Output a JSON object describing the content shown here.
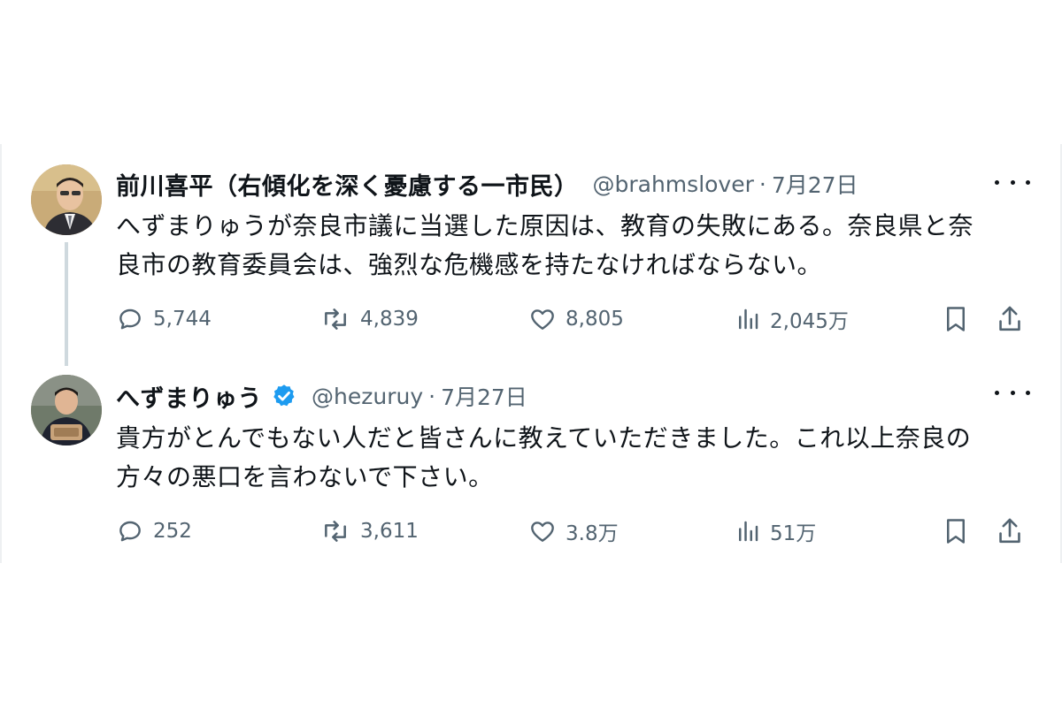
{
  "tweets": [
    {
      "author_name": "前川喜平（右傾化を深く憂慮する一市民）",
      "handle": "@brahmslover",
      "separator": "·",
      "date": "7月27日",
      "verified": false,
      "text_line1": "へずまりゅうが奈良市議に当選した原因は、教育の失敗にある。奈良県と奈",
      "text_line2": "良市の教育委員会は、強烈な危機感を持たなければならない。",
      "replies": "5,744",
      "retweets": "4,839",
      "likes": "8,805",
      "views": "2,045万"
    },
    {
      "author_name": "へずまりゅう",
      "handle": "@hezuruy",
      "separator": "·",
      "date": "7月27日",
      "verified": true,
      "text_line1": "貴方がとんでもない人だと皆さんに教えていただきました。これ以上奈良の",
      "text_line2": "方々の悪口を言わないで下さい。",
      "replies": "252",
      "retweets": "3,611",
      "likes": "3.8万",
      "views": "51万"
    }
  ],
  "icons": {
    "reply": "reply-icon",
    "retweet": "retweet-icon",
    "like": "heart-icon",
    "views": "views-chart-icon",
    "bookmark": "bookmark-icon",
    "share": "share-icon",
    "more": "more-dots-icon",
    "verified": "verified-badge-icon"
  },
  "colors": {
    "text": "#0f1419",
    "muted": "#536471",
    "verified": "#1d9bf0",
    "thread_line": "#cfd9de"
  }
}
